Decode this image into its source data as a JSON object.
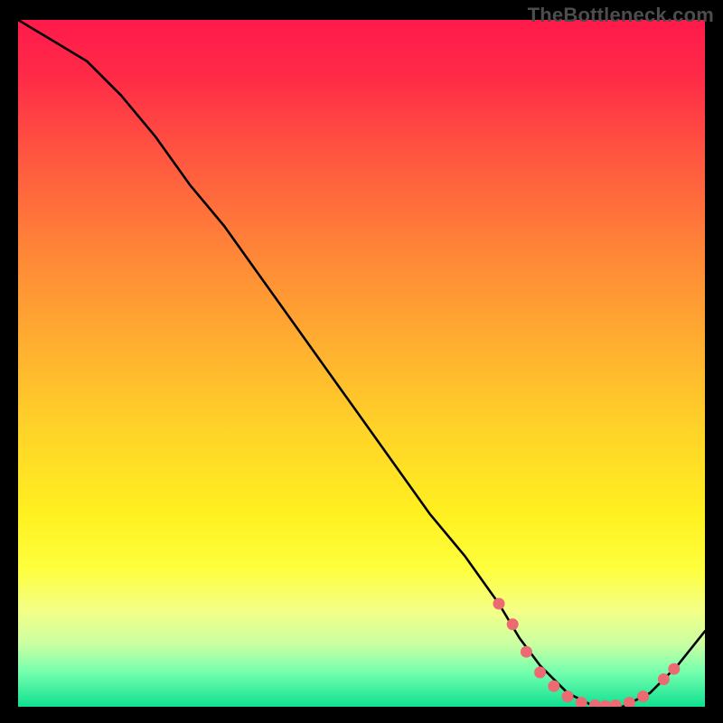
{
  "watermark": "TheBottleneck.com",
  "gradient_colors": {
    "top": "#ff1a4b",
    "mid_upper": "#ff8338",
    "mid": "#ffd428",
    "mid_lower": "#feff3d",
    "bottom": "#10e090"
  },
  "chart_data": {
    "type": "line",
    "title": "",
    "xlabel": "",
    "ylabel": "",
    "xlim": [
      0,
      100
    ],
    "ylim": [
      0,
      100
    ],
    "curve": {
      "name": "bottleneck-curve",
      "x": [
        0,
        5,
        10,
        15,
        20,
        25,
        30,
        35,
        40,
        45,
        50,
        55,
        60,
        65,
        70,
        73,
        76,
        80,
        84,
        88,
        92,
        96,
        100
      ],
      "y": [
        100,
        97,
        94,
        89,
        83,
        76,
        70,
        63,
        56,
        49,
        42,
        35,
        28,
        22,
        15,
        10,
        6,
        2,
        0,
        0,
        2,
        6,
        11
      ]
    },
    "markers": {
      "name": "highlight-dots",
      "color": "#ec6b72",
      "points": [
        {
          "x": 70,
          "y": 15
        },
        {
          "x": 72,
          "y": 12
        },
        {
          "x": 74,
          "y": 8
        },
        {
          "x": 76,
          "y": 5
        },
        {
          "x": 78,
          "y": 3
        },
        {
          "x": 80,
          "y": 1.5
        },
        {
          "x": 82,
          "y": 0.6
        },
        {
          "x": 84,
          "y": 0.2
        },
        {
          "x": 85.5,
          "y": 0.1
        },
        {
          "x": 87,
          "y": 0.2
        },
        {
          "x": 89,
          "y": 0.6
        },
        {
          "x": 91,
          "y": 1.5
        },
        {
          "x": 94,
          "y": 4
        },
        {
          "x": 95.5,
          "y": 5.5
        }
      ]
    }
  }
}
